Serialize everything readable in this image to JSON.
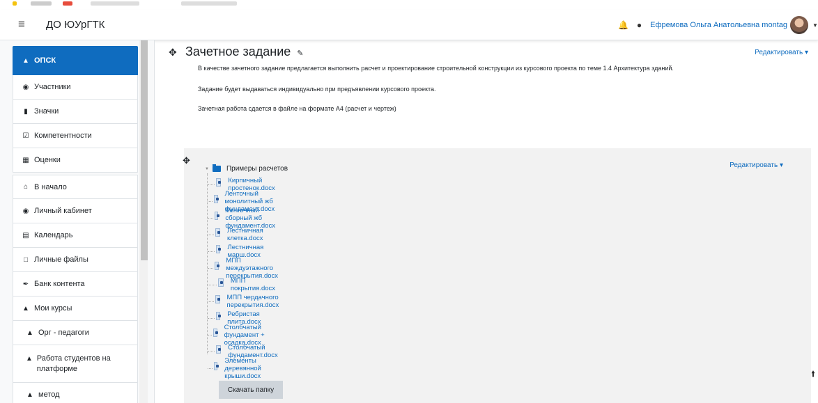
{
  "navbar": {
    "site_name": "ДО ЮУрГТК",
    "user_name": "Ефремова Ольга Анатольевна montag"
  },
  "drawer": {
    "items": [
      {
        "label": "ОПСК",
        "icon": "graduation-cap-icon"
      },
      {
        "label": "Участники",
        "icon": "users-icon"
      },
      {
        "label": "Значки",
        "icon": "shield-icon"
      },
      {
        "label": "Компетентности",
        "icon": "checkbox-icon"
      },
      {
        "label": "Оценки",
        "icon": "table-icon"
      },
      {
        "label": "В начало",
        "icon": "home-icon"
      },
      {
        "label": "Личный кабинет",
        "icon": "dashboard-icon"
      },
      {
        "label": "Календарь",
        "icon": "calendar-icon"
      },
      {
        "label": "Личные файлы",
        "icon": "file-icon"
      },
      {
        "label": "Банк контента",
        "icon": "paint-brush-icon"
      },
      {
        "label": "Мои курсы",
        "icon": "graduation-cap-icon"
      },
      {
        "label": "Орг - педагоги",
        "icon": "graduation-cap-icon"
      },
      {
        "label": "Работа студентов на платформе",
        "icon": "graduation-cap-icon"
      },
      {
        "label": "метод",
        "icon": "graduation-cap-icon"
      }
    ]
  },
  "section": {
    "title": "Зачетное задание",
    "edit_label": "Редактировать",
    "summary": [
      "В качестве зачетного задание предлагается выполнить расчет и проектирование  строительной конструкции из курсового проекта по теме 1.4 Архитектура зданий.",
      "Задание будет выдаваться индивидуально при предъявлении курсового проекта.",
      "Зачетная работа сдается в файле на формате А4 (расчет и чертеж)"
    ]
  },
  "folder": {
    "name": "Примеры расчетов",
    "edit_label": "Редактировать",
    "download_label": "Скачать папку",
    "files": [
      "Кирпичный простенок.docx",
      "Ленточный монолитный жб фундамент.docx",
      "Ленточный сборный жб фундамент.docx",
      "Лестничная клетка.docx",
      "Лестничная марш.docx",
      "МПП междуэтажного перекрытия.docx",
      "МПП покрытия.docx",
      "МПП чердачного перекрытия.docx",
      "Ребристая плита.docx",
      "Столбчатый фундамент + осадка.docx",
      "Столбчатый фундамент.docx",
      "Элементы деревянной крыши.docx"
    ]
  },
  "colors": {
    "accent": "#0f6cbf",
    "folder_bg": "#f2f2f2"
  }
}
